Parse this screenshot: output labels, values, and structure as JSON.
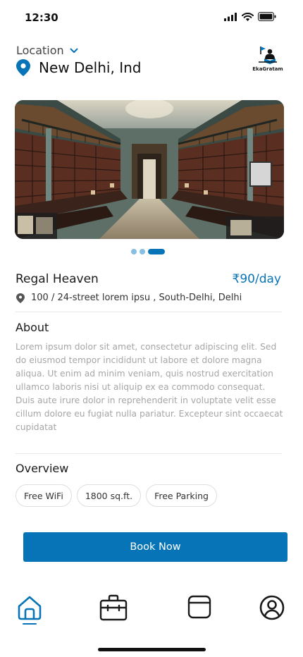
{
  "status_bar": {
    "time": "12:30"
  },
  "location": {
    "label": "Location",
    "city": "New Delhi, Ind"
  },
  "brand": {
    "name": "EkaGratam"
  },
  "carousel": {
    "count": 3,
    "active_index": 2
  },
  "listing": {
    "title": "Regal Heaven",
    "price": "₹90/day",
    "address": "100 / 24-street lorem ipsu , South-Delhi, Delhi"
  },
  "about": {
    "title": "About",
    "text": "Lorem ipsum dolor sit amet, consectetur adipiscing elit. Sed do eiusmod tempor incididunt ut labore et dolore magna aliqua. Ut enim ad minim veniam, quis nostrud exercitation ullamco laboris nisi ut aliquip ex ea commodo consequat. Duis aute irure dolor in reprehenderit in voluptate velit esse cillum dolore eu fugiat nulla pariatur. Excepteur sint occaecat cupidatat"
  },
  "overview": {
    "title": "Overview",
    "features": [
      "Free WiFi",
      "1800 sq.ft.",
      "Free Parking"
    ]
  },
  "actions": {
    "book_label": "Book Now"
  },
  "bottom_nav": {
    "items": [
      {
        "icon": "home-icon",
        "active": true
      },
      {
        "icon": "briefcase-icon",
        "active": false
      },
      {
        "icon": "window-icon",
        "active": false
      },
      {
        "icon": "profile-icon",
        "active": false
      }
    ]
  },
  "colors": {
    "accent": "#0774b8",
    "dot_inactive": "#86bfe3",
    "body_text": "#a6a6a6"
  }
}
